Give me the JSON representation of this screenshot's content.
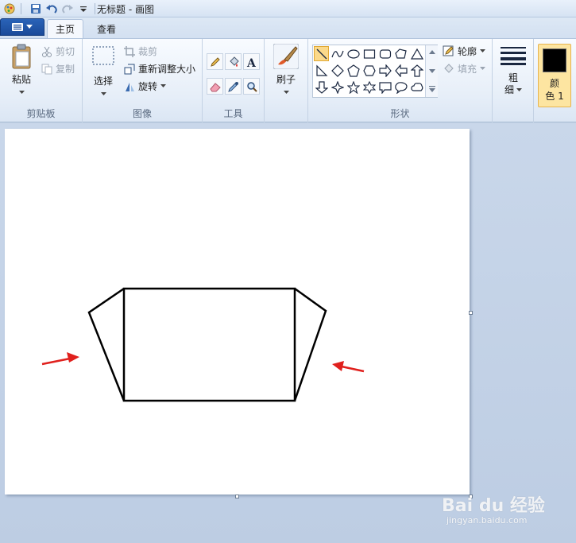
{
  "window": {
    "title": "无标题 - 画图"
  },
  "tabs": [
    {
      "label": "主页"
    },
    {
      "label": "查看"
    }
  ],
  "clipboard": {
    "paste": "粘贴",
    "cut": "剪切",
    "copy": "复制",
    "group": "剪贴板"
  },
  "image": {
    "select": "选择",
    "crop": "裁剪",
    "resize": "重新调整大小",
    "rotate": "旋转",
    "group": "图像"
  },
  "tools": {
    "group": "工具"
  },
  "brushes": {
    "label": "刷子"
  },
  "shapes": {
    "outline": "轮廓",
    "fill": "填充",
    "group": "形状"
  },
  "size": {
    "label_line1": "粗",
    "label_line2": "细"
  },
  "color1": {
    "line1": "颜",
    "line2": "色 1",
    "value": "#000000"
  },
  "watermark": {
    "logo": "Bai du 经验",
    "url": "jingyan.baidu.com"
  },
  "colors": {
    "arrow": "#e0201d",
    "ink": "#000000",
    "canvas": "#ffffff"
  }
}
